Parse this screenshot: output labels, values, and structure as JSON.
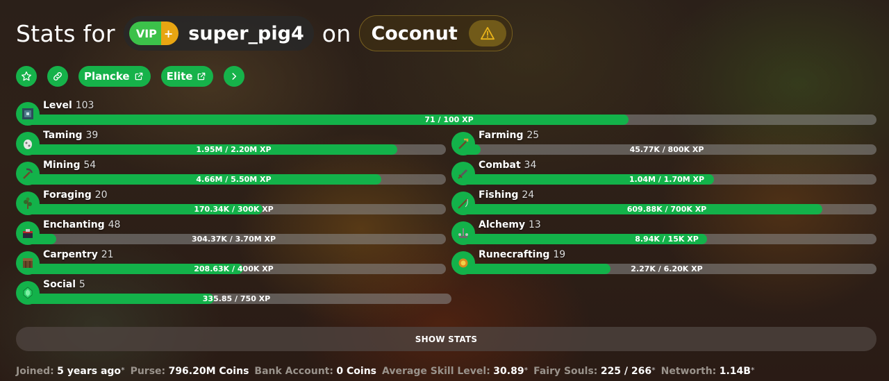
{
  "header": {
    "prefix": "Stats for",
    "rank_vip": "VIP",
    "rank_plus": "+",
    "player_name": "super_pig4",
    "connector": "on",
    "profile_name": "Coconut"
  },
  "links": {
    "plancke": "Plancke",
    "elite": "Elite"
  },
  "level": {
    "name": "Level",
    "value": "103",
    "progress_text": "71 / 100 XP",
    "progress": 0.71
  },
  "skills_left": [
    {
      "name": "Taming",
      "value": "39",
      "progress_text": "1.95M / 2.20M XP",
      "progress": 0.886,
      "icon": "spawn-egg-icon"
    },
    {
      "name": "Mining",
      "value": "54",
      "progress_text": "4.66M / 5.50M XP",
      "progress": 0.847,
      "icon": "pickaxe-icon"
    },
    {
      "name": "Foraging",
      "value": "20",
      "progress_text": "170.34K / 300K XP",
      "progress": 0.568,
      "icon": "sapling-icon"
    },
    {
      "name": "Enchanting",
      "value": "48",
      "progress_text": "304.37K / 3.70M XP",
      "progress": 0.082,
      "icon": "enchanting-table-icon"
    },
    {
      "name": "Carpentry",
      "value": "21",
      "progress_text": "208.63K / 400K XP",
      "progress": 0.522,
      "icon": "crafting-table-icon"
    },
    {
      "name": "Social",
      "value": "5",
      "progress_text": "335.85 / 750 XP",
      "progress": 0.448,
      "icon": "emerald-icon"
    }
  ],
  "skills_right": [
    {
      "name": "Farming",
      "value": "25",
      "progress_text": "45.77K / 800K XP",
      "progress": 0.057,
      "icon": "hoe-icon"
    },
    {
      "name": "Combat",
      "value": "34",
      "progress_text": "1.04M / 1.70M XP",
      "progress": 0.612,
      "icon": "sword-icon"
    },
    {
      "name": "Fishing",
      "value": "24",
      "progress_text": "609.88K / 700K XP",
      "progress": 0.871,
      "icon": "fishing-rod-icon"
    },
    {
      "name": "Alchemy",
      "value": "13",
      "progress_text": "8.94K / 15K XP",
      "progress": 0.596,
      "icon": "brewing-stand-icon"
    },
    {
      "name": "Runecrafting",
      "value": "19",
      "progress_text": "2.27K / 6.20K XP",
      "progress": 0.366,
      "icon": "magma-cream-icon"
    }
  ],
  "show_stats_label": "SHOW STATS",
  "footer": [
    {
      "label": "Joined:",
      "value": "5 years ago",
      "ast": "*"
    },
    {
      "label": "Purse:",
      "value": "796.20M Coins",
      "ast": ""
    },
    {
      "label": "Bank Account:",
      "value": "0 Coins",
      "ast": ""
    },
    {
      "label": "Average Skill Level:",
      "value": "30.89",
      "ast": "*"
    },
    {
      "label": "Fairy Souls:",
      "value": "225 / 266",
      "ast": "*"
    },
    {
      "label": "Networth:",
      "value": "1.14B",
      "ast": "*"
    }
  ],
  "colors": {
    "accent_green": "#13b24a",
    "rank_vip": "#3cc14a",
    "rank_plus": "#e8a512",
    "warning": "#e8b31a"
  }
}
